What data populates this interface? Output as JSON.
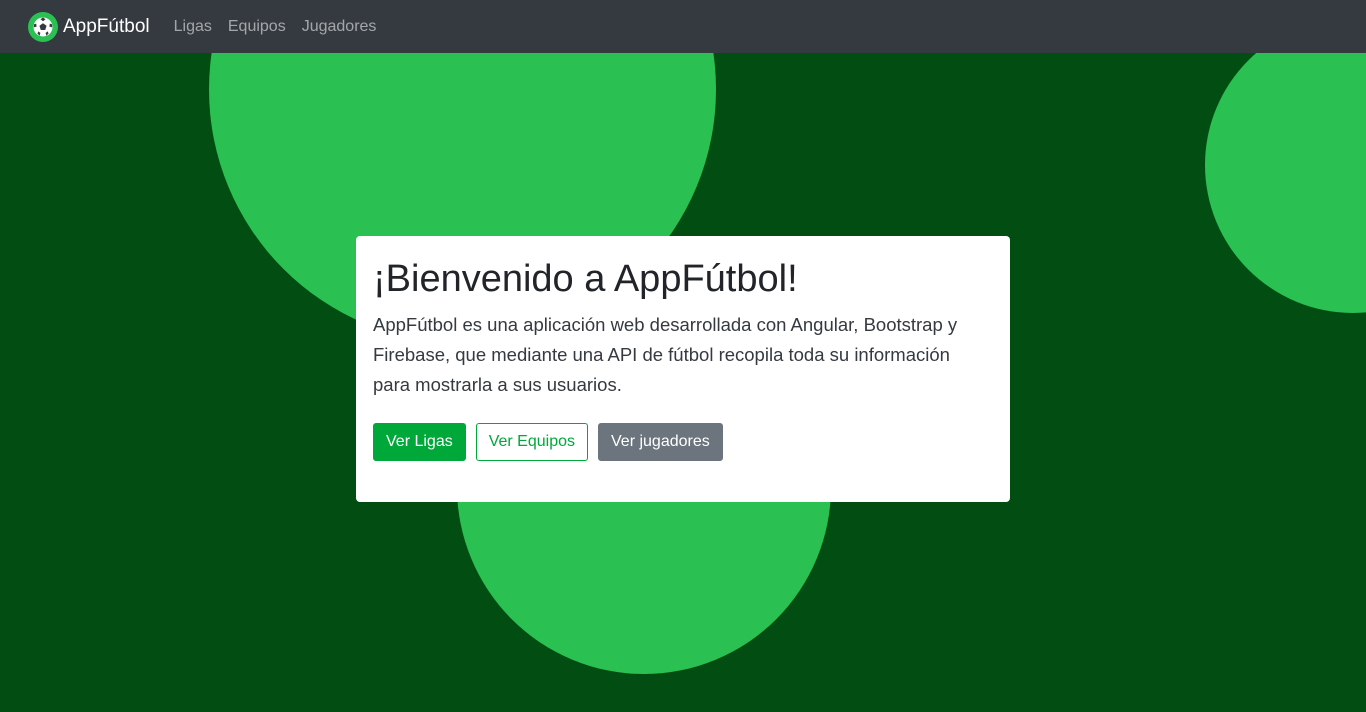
{
  "navbar": {
    "brand": "AppFútbol",
    "logo_icon": "soccer-ball-icon",
    "links": [
      "Ligas",
      "Equipos",
      "Jugadores"
    ]
  },
  "hero": {
    "title": "¡Bienvenido a AppFútbol!",
    "description": "AppFútbol es una aplicación web desarrollada con Angular, Bootstrap y Firebase, que mediante una API de fútbol recopila toda su información para mostrarla a sus usuarios.",
    "buttons": {
      "ligas": "Ver Ligas",
      "equipos": "Ver Equipos",
      "jugadores": "Ver jugadores"
    }
  },
  "colors": {
    "navbar": "#343a40",
    "background": "#024d12",
    "circles": "#2ac152",
    "primary_green": "#00a83a",
    "secondary": "#6c757d"
  }
}
